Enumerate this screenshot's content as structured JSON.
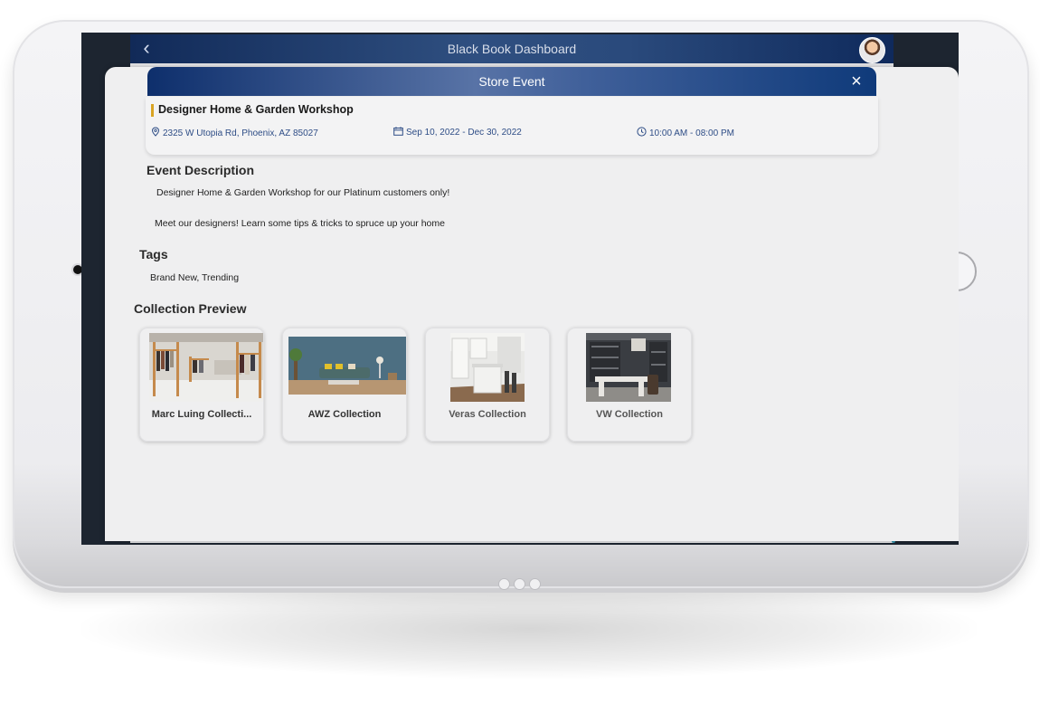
{
  "app": {
    "title": "Black Book Dashboard"
  },
  "modal": {
    "title": "Store Event",
    "close_symbol": "×"
  },
  "event": {
    "name": "Designer Home & Garden Workshop",
    "address": "2325 W Utopia Rd, Phoenix, AZ 85027",
    "dates": "Sep 10, 2022 - Dec 30, 2022",
    "hours": "10:00 AM - 08:00 PM"
  },
  "description": {
    "heading": "Event Description",
    "line1": "Designer Home & Garden Workshop for our Platinum customers only!",
    "line2": "Meet our designers! Learn some tips & tricks to spruce up your home"
  },
  "tags": {
    "heading": "Tags",
    "value": "Brand New, Trending"
  },
  "collections": {
    "heading": "Collection Preview",
    "items": [
      {
        "label": "Marc Luing Collecti...",
        "image": "clothing-store-photo"
      },
      {
        "label": "AWZ Collection",
        "image": "living-room-photo"
      },
      {
        "label": "Veras Collection",
        "image": "kitchen-photo"
      },
      {
        "label": "VW Collection",
        "image": "home-office-photo"
      }
    ]
  },
  "icons": {
    "back": "chevron-left-icon",
    "location": "map-pin-icon",
    "calendar": "calendar-icon",
    "clock": "clock-icon",
    "close": "close-icon"
  },
  "colors": {
    "header_navy": "#112a58",
    "accent_gold": "#d9a423",
    "meta_blue": "#2e4d86",
    "device_silver": "#ececef"
  }
}
